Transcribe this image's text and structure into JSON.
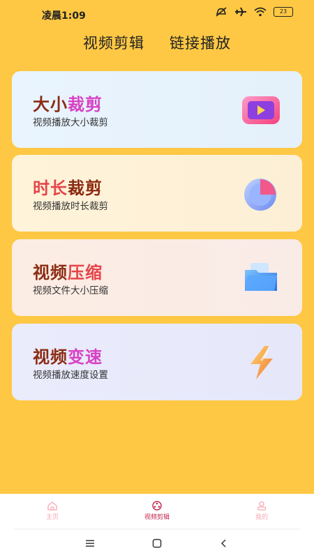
{
  "status": {
    "time": "凌晨1:09",
    "battery": "23"
  },
  "tabs": [
    {
      "label": "视频剪辑"
    },
    {
      "label": "链接播放"
    }
  ],
  "cards": [
    {
      "title_a": "大小",
      "title_b": "裁剪",
      "subtitle": "视频播放大小裁剪",
      "icon": "play-screen-icon"
    },
    {
      "title_a": "时长",
      "title_b": "裁剪",
      "subtitle": "视频播放时长裁剪",
      "icon": "pie-clock-icon"
    },
    {
      "title_a": "视频",
      "title_b": "压缩",
      "subtitle": "视频文件大小压缩",
      "icon": "folder-icon"
    },
    {
      "title_a": "视频",
      "title_b": "变速",
      "subtitle": "视频播放速度设置",
      "icon": "lightning-icon"
    }
  ],
  "bottom_nav": [
    {
      "label": "主页",
      "icon": "home-icon"
    },
    {
      "label": "视频剪辑",
      "icon": "film-reel-icon",
      "active": true
    },
    {
      "label": "我的",
      "icon": "user-icon"
    }
  ],
  "colors": {
    "background": "#FEC844",
    "nav_active": "#C4264E",
    "nav_inactive": "#F5A7B2"
  }
}
